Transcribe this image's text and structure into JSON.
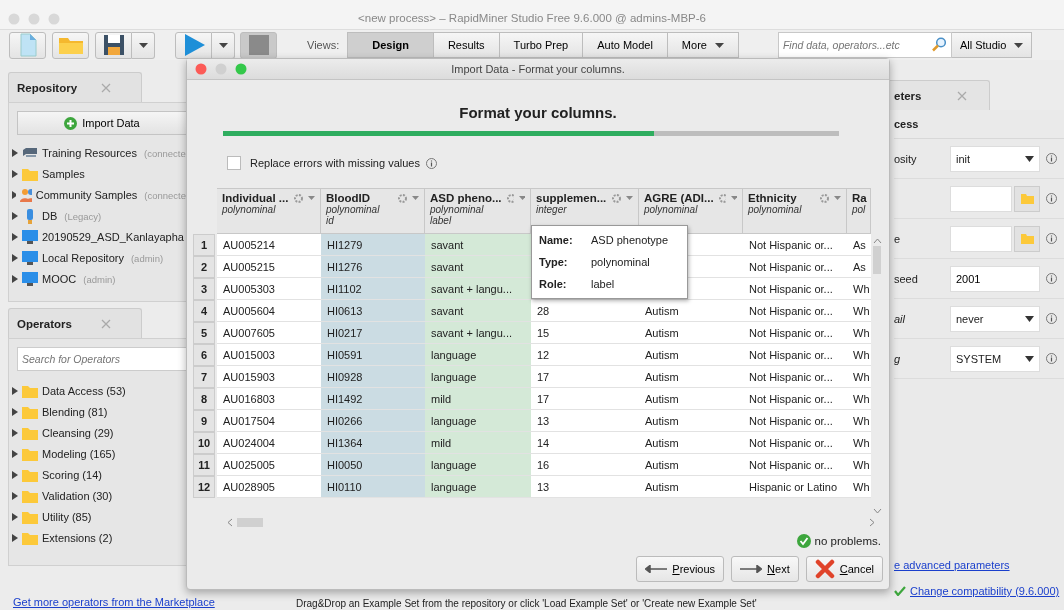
{
  "window": {
    "title": "<new process> – RapidMiner Studio Free 9.6.000 @ admins-MBP-6"
  },
  "toolbar": {
    "views_label": "Views:",
    "views": [
      {
        "label": "Design",
        "selected": true
      },
      {
        "label": "Results",
        "selected": false
      },
      {
        "label": "Turbo Prep",
        "selected": false
      },
      {
        "label": "Auto Model",
        "selected": false
      }
    ],
    "more": "More",
    "search": {
      "placeholder": "Find data, operators...etc"
    },
    "scope": "All Studio"
  },
  "repository": {
    "tab": "Repository",
    "import_button": "Import Data",
    "items": [
      {
        "label": "Training Resources",
        "note": "(connecte",
        "kind": "server"
      },
      {
        "label": "Samples",
        "kind": "folder"
      },
      {
        "label": "Community Samples",
        "note": "(connecte",
        "kind": "people"
      },
      {
        "label": "DB",
        "note": "(Legacy)",
        "kind": "database"
      },
      {
        "label": "20190529_ASD_Kanlayapha",
        "kind": "computer"
      },
      {
        "label": "Local Repository",
        "note": "(admin)",
        "kind": "computer"
      },
      {
        "label": "MOOC",
        "note": "(admin)",
        "kind": "computer"
      }
    ]
  },
  "operators": {
    "tab": "Operators",
    "search": {
      "placeholder": "Search for Operators"
    },
    "items": [
      "Data Access (53)",
      "Blending (81)",
      "Cleansing (29)",
      "Modeling (165)",
      "Scoring (14)",
      "Validation (30)",
      "Utility (85)",
      "Extensions (2)"
    ],
    "marketplace_link": "Get more operators from the Marketplace"
  },
  "parameters": {
    "tab": "eters",
    "section": "cess",
    "params": [
      {
        "label": "osity",
        "kind": "select",
        "value": "init",
        "expert": false
      },
      {
        "kind": "file"
      },
      {
        "label": "e",
        "kind": "file",
        "expert": false
      },
      {
        "label": "seed",
        "kind": "text",
        "value": "2001",
        "expert": false
      },
      {
        "label": "ail",
        "kind": "select",
        "value": "never",
        "expert": true
      },
      {
        "label": "g",
        "kind": "select",
        "value": "SYSTEM",
        "expert": true
      }
    ],
    "advanced_link": "e advanced parameters",
    "compat_link": "Change compatibility (9.6.000)"
  },
  "process_hint": "Drag&Drop an Example Set from the repository or click 'Load Example Set' or 'Create new Example Set'",
  "dialog": {
    "title": "Import Data - Format your columns.",
    "heading": "Format your columns.",
    "progress": {
      "level": 0.7
    },
    "replace_errors": {
      "label": "Replace errors with missing values",
      "checked": false
    },
    "columns": [
      {
        "name": "Individual ...",
        "type": "polynominal"
      },
      {
        "name": "BloodID",
        "type": "polynominal",
        "role": "id",
        "color": "#cbdce3"
      },
      {
        "name": "ASD pheno...",
        "type": "polynominal",
        "role": "label",
        "color": "#d4e9d7"
      },
      {
        "name": "supplemen...",
        "type": "integer"
      },
      {
        "name": "AGRE (ADI...",
        "type": "polynominal"
      },
      {
        "name": "Ethnicity",
        "type": "polynominal"
      },
      {
        "name": "Ra",
        "type": "pol"
      }
    ],
    "rows": [
      {
        "n": "1",
        "cells": [
          "AU005214",
          "HI1279",
          "savant",
          null,
          null,
          "Not Hispanic or...",
          "As"
        ]
      },
      {
        "n": "2",
        "cells": [
          "AU005215",
          "HI1276",
          "savant",
          null,
          null,
          "Not Hispanic or...",
          "As"
        ]
      },
      {
        "n": "3",
        "cells": [
          "AU005303",
          "HI1102",
          "savant + langu...",
          null,
          null,
          "Not Hispanic or...",
          "Wh"
        ]
      },
      {
        "n": "4",
        "cells": [
          "AU005604",
          "HI0613",
          "savant",
          "28",
          "Autism",
          "Not Hispanic or...",
          "Wh"
        ]
      },
      {
        "n": "5",
        "cells": [
          "AU007605",
          "HI0217",
          "savant + langu...",
          "15",
          "Autism",
          "Not Hispanic or...",
          "Wh"
        ]
      },
      {
        "n": "6",
        "cells": [
          "AU015003",
          "HI0591",
          "language",
          "12",
          "Autism",
          "Not Hispanic or...",
          "Wh"
        ]
      },
      {
        "n": "7",
        "cells": [
          "AU015903",
          "HI0928",
          "language",
          "17",
          "Autism",
          "Not Hispanic or...",
          "Wh"
        ]
      },
      {
        "n": "8",
        "cells": [
          "AU016803",
          "HI1492",
          "mild",
          "17",
          "Autism",
          "Not Hispanic or...",
          "Wh"
        ]
      },
      {
        "n": "9",
        "cells": [
          "AU017504",
          "HI0266",
          "language",
          "13",
          "Autism",
          "Not Hispanic or...",
          "Wh"
        ]
      },
      {
        "n": "10",
        "cells": [
          "AU024004",
          "HI1364",
          "mild",
          "14",
          "Autism",
          "Not Hispanic or...",
          "Wh"
        ]
      },
      {
        "n": "11",
        "cells": [
          "AU025005",
          "HI0050",
          "language",
          "16",
          "Autism",
          "Not Hispanic or...",
          "Wh"
        ]
      },
      {
        "n": "12",
        "cells": [
          "AU028905",
          "HI0110",
          "language",
          "13",
          "Autism",
          "Hispanic or Latino",
          "Wh"
        ]
      }
    ],
    "tooltip": [
      {
        "key": "Name:",
        "value": "ASD phenotype"
      },
      {
        "key": "Type:",
        "value": "polynominal"
      },
      {
        "key": "Role:",
        "value": "label"
      }
    ],
    "status": "no problems.",
    "buttons": [
      {
        "label": "Previous",
        "kind": "previous"
      },
      {
        "label": "Next",
        "kind": "next"
      },
      {
        "label": "Cancel",
        "kind": "cancel"
      }
    ]
  }
}
